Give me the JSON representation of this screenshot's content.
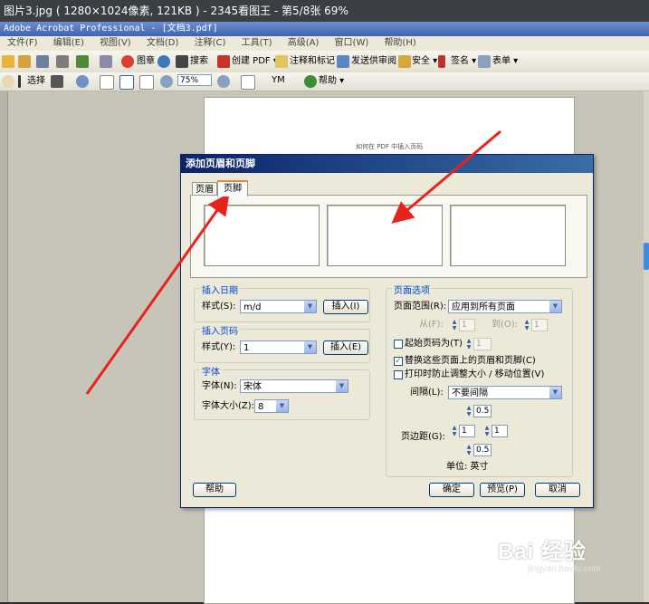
{
  "viewer": {
    "title": "图片3.jpg ( 1280×1024像素, 121KB ) - 2345看图王 - 第5/8张 69%"
  },
  "app": {
    "title": "Adobe Acrobat Professional - [文档3.pdf]",
    "menu": [
      "文件(F)",
      "编辑(E)",
      "视图(V)",
      "文档(D)",
      "注释(C)",
      "工具(T)",
      "高级(A)",
      "窗口(W)",
      "帮助(H)"
    ]
  },
  "toolbar": {
    "image_label": "图章",
    "search_label": "搜索",
    "create_pdf": "创建 PDF ▾",
    "comment_mark": "注释和标记 ▾",
    "send_review": "发送供审阅 ▾",
    "security": "安全 ▾",
    "sign": "签名 ▾",
    "forms": "表单 ▾",
    "select_label": "选择",
    "zoom_value": "75%",
    "help_label": "帮助 ▾"
  },
  "page": {
    "text": "如何在 PDF 中插入页码"
  },
  "dialog": {
    "title": "添加页眉和页脚",
    "tabs": [
      "页眉",
      "页脚"
    ],
    "insert_date": {
      "title": "插入日期",
      "style_label": "样式(S):",
      "style_value": "m/d",
      "insert_button": "插入(I)"
    },
    "insert_page": {
      "title": "插入页码",
      "style_label": "样式(Y):",
      "style_value": "1",
      "insert_button": "插入(E)"
    },
    "font": {
      "title": "字体",
      "name_label": "字体(N):",
      "name_value": "宋体",
      "size_label": "字体大小(Z):",
      "size_value": "8"
    },
    "page_options": {
      "title": "页面选项",
      "range_label": "页面范围(R):",
      "range_value": "应用到所有页面",
      "from_label": "从(F):",
      "from_value": "1",
      "to_label": "到(O):",
      "to_value": "1",
      "start_page_label": "起始页码为(T)",
      "start_page_value": "1",
      "replace_label": "替换这些页面上的页眉和页脚(C)",
      "replace_checked": true,
      "shrink_label": "打印时防止调整大小 / 移动位置(V)",
      "shrink_checked": false,
      "spacing_label": "间隔(L):",
      "spacing_value": "不要间隔",
      "offset_top": "0.5",
      "margins_label": "页边距(G):",
      "margin_left": "1",
      "margin_right": "1",
      "offset_bottom": "0.5",
      "units_label": "单位: 英寸"
    },
    "buttons": {
      "help": "帮助",
      "ok": "确定",
      "preview": "预览(P)",
      "cancel": "取消"
    }
  },
  "watermark": {
    "brand": "Bai 经验",
    "url": "jingyan.baidu.com"
  },
  "colors": {
    "annotation_arrow": "#e8231d",
    "title_bar": "#0a246a",
    "group_title": "#0046d5"
  }
}
